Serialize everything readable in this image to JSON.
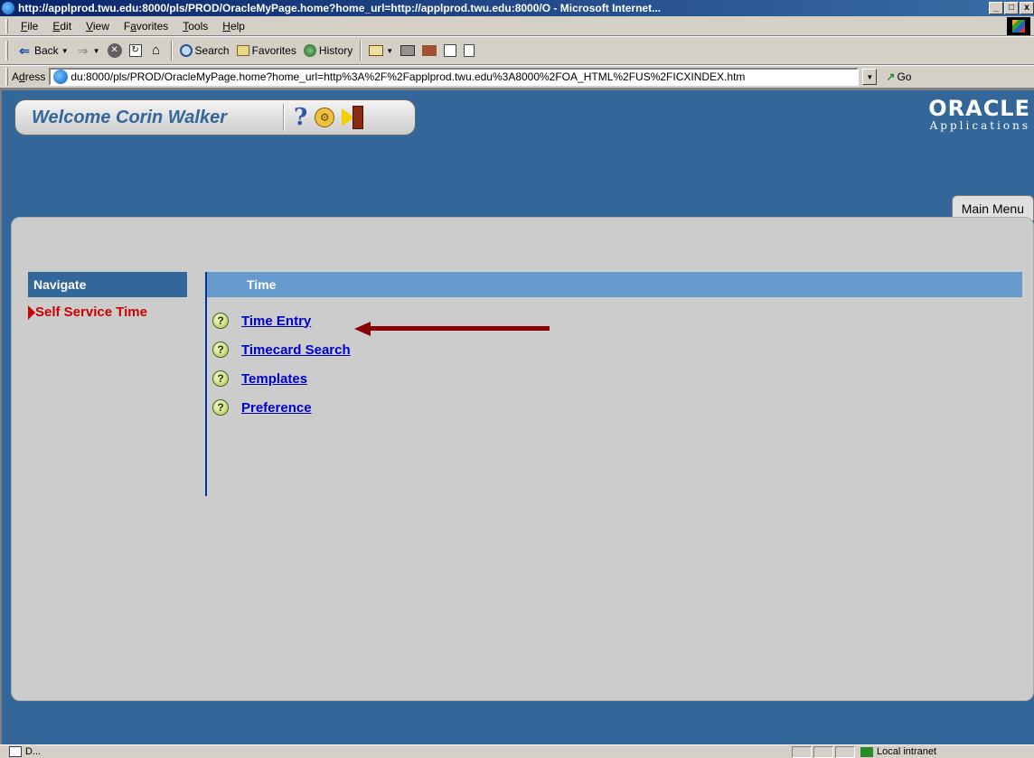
{
  "window": {
    "title": "http://applprod.twu.edu:8000/pls/PROD/OracleMyPage.home?home_url=http://applprod.twu.edu:8000/O - Microsoft Internet...",
    "minimize": "_",
    "maximize": "□",
    "close": "x"
  },
  "menubar": {
    "items": [
      {
        "label": "File",
        "accel": "F",
        "rest": "ile"
      },
      {
        "label": "Edit",
        "accel": "E",
        "rest": "dit"
      },
      {
        "label": "View",
        "accel": "V",
        "rest": "iew"
      },
      {
        "label": "Favorites",
        "accel": "a",
        "pre": "F",
        "rest": "vorites"
      },
      {
        "label": "Tools",
        "accel": "T",
        "rest": "ools"
      },
      {
        "label": "Help",
        "accel": "H",
        "rest": "elp"
      }
    ]
  },
  "toolbar": {
    "back": "Back",
    "search": "Search",
    "favorites": "Favorites",
    "history": "History"
  },
  "address": {
    "label": "Address",
    "accel": "d",
    "url": "du:8000/pls/PROD/OracleMyPage.home?home_url=http%3A%2F%2Fapplprod.twu.edu%3A8000%2FOA_HTML%2FUS%2FICXINDEX.htm",
    "go": "Go"
  },
  "page": {
    "welcome": "Welcome Corin Walker",
    "help_glyph": "?",
    "logo_word": "ORACLE",
    "logo_sub": "Applications",
    "tab": "Main Menu",
    "navigate": {
      "header": "Navigate",
      "items": [
        "Self Service Time"
      ]
    },
    "time": {
      "header": "Time",
      "items": [
        "Time Entry",
        "Timecard Search",
        "Templates",
        "Preference"
      ]
    }
  },
  "status": {
    "text": "D...",
    "zone": "Local intranet"
  },
  "colors": {
    "oracle_blue": "#336699",
    "nav_red": "#cc0000",
    "link_blue": "#0000cc",
    "annotation_arrow": "#8b0000"
  }
}
